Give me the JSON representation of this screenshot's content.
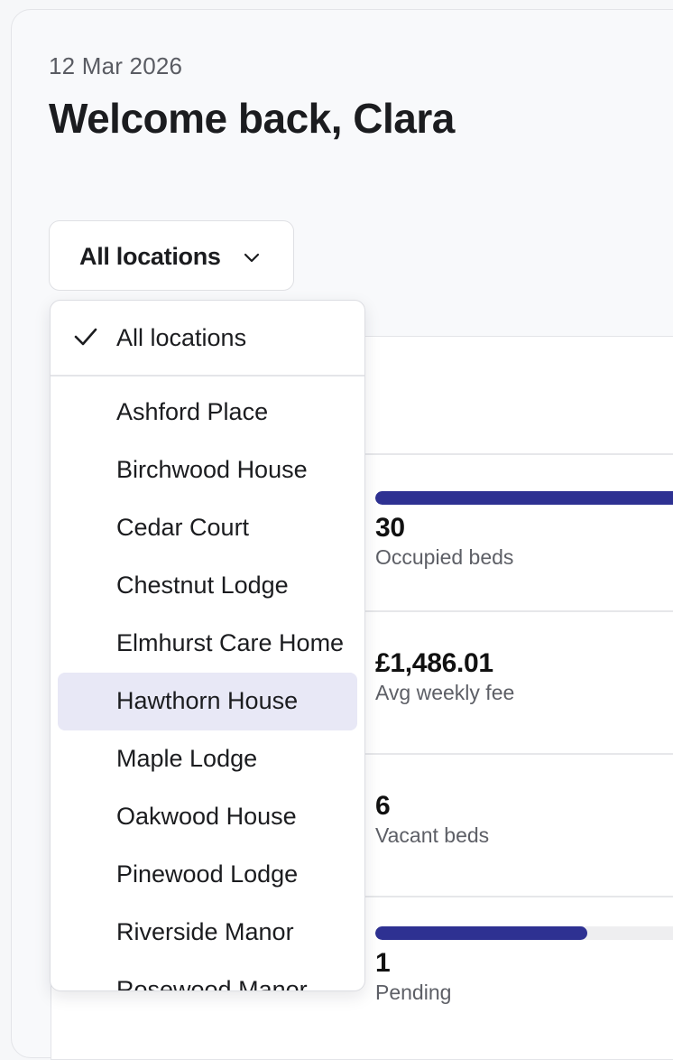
{
  "header": {
    "date": "12 Mar 2026",
    "welcome": "Welcome back, Clara"
  },
  "location_select": {
    "selected": "All locations",
    "icon": "chevron-down-icon"
  },
  "dropdown": {
    "options": [
      "All locations",
      "Ashford Place",
      "Birchwood House",
      "Cedar Court",
      "Chestnut Lodge",
      "Elmhurst Care Home",
      "Hawthorn House",
      "Maple Lodge",
      "Oakwood House",
      "Pinewood Lodge",
      "Riverside Manor",
      "Rosewood Manor"
    ],
    "checked": "All locations",
    "highlighted": "Hawthorn House",
    "highlight_color": "#e8e8f6"
  },
  "stats": [
    {
      "value": "30",
      "label": "Occupied beds",
      "bar_fraction": 1.0
    },
    {
      "value": "£1,486.01",
      "label": "Avg weekly fee"
    },
    {
      "value": "6",
      "label": "Vacant beds"
    },
    {
      "value": "1",
      "label": "Pending",
      "bar_fraction": 0.69
    }
  ],
  "colors": {
    "accent": "#2e3192",
    "track": "#eeeef0"
  }
}
